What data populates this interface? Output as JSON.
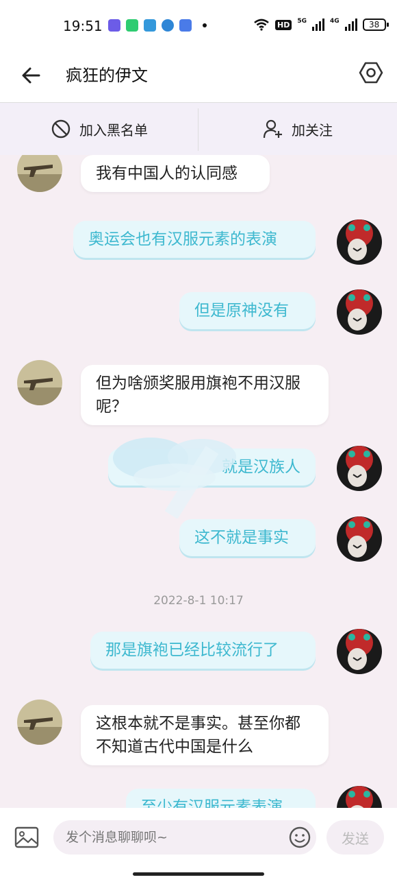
{
  "status_bar": {
    "time": "19:51",
    "battery": "38",
    "hd_label": "HD",
    "net1": "5G",
    "net2": "4G"
  },
  "header": {
    "title": "疯狂的伊文"
  },
  "actions": {
    "blacklist": "加入黑名单",
    "follow": "加关注"
  },
  "messages": [
    {
      "side": "left",
      "text": "我有中国人的认同感"
    },
    {
      "side": "right",
      "text": "奥运会也有汉服元素的表演"
    },
    {
      "side": "right",
      "text": "但是原神没有"
    },
    {
      "side": "left",
      "text": "但为啥颁奖服用旗袍不用汉服呢？"
    },
    {
      "side": "right",
      "text": "就是汉族人"
    },
    {
      "side": "right",
      "text": "这不就是事实"
    },
    {
      "side": "right",
      "text": "那是旗袍已经比较流行了"
    },
    {
      "side": "left",
      "text": "这根本就不是事实。甚至你都不知道古代中国是什么"
    },
    {
      "side": "right",
      "text": "至少有汉服元素表演"
    }
  ],
  "timestamp": "2022-8-1 10:17",
  "input": {
    "placeholder": "发个消息聊聊呗~",
    "send_label": "发送"
  },
  "colors": {
    "right_bubble_text": "#3db8cf",
    "right_bubble_bg": "#e6f7fb",
    "chat_bg": "#f6eef3"
  }
}
